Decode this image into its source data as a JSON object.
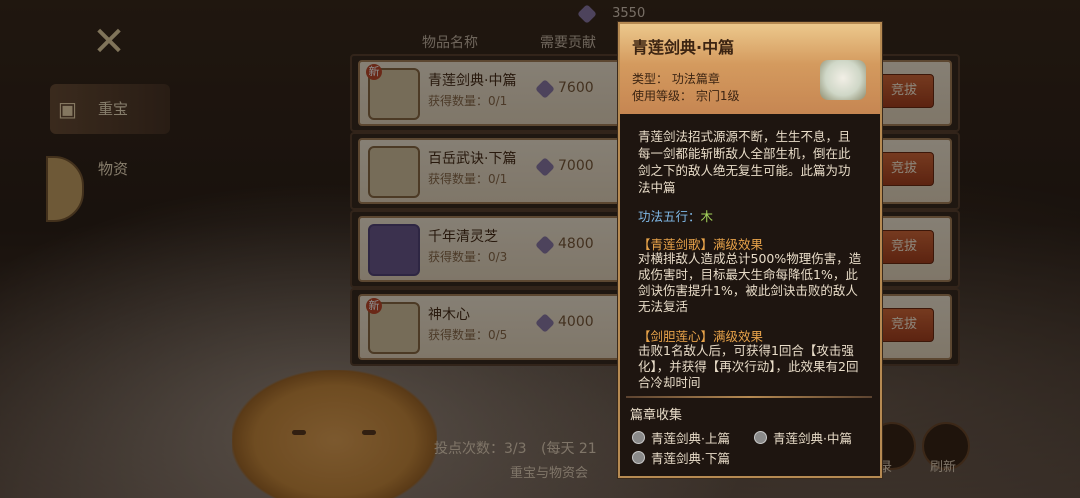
{
  "top": {
    "currency_value": "3550"
  },
  "nav": {
    "items": [
      {
        "label": "重宝",
        "active": true
      },
      {
        "label": "物资",
        "active": false
      }
    ]
  },
  "list": {
    "headers": [
      "物品名称",
      "需要贡献"
    ],
    "rows": [
      {
        "name": "青莲剑典·中篇",
        "count": "获得数量：0/1",
        "cost": "7600",
        "badge": "新",
        "bid": "竞拔"
      },
      {
        "name": "百岳武诀·下篇",
        "count": "获得数量：0/1",
        "cost": "7000",
        "badge": "",
        "bid": "竞拔"
      },
      {
        "name": "千年清灵芝",
        "count": "获得数量：0/3",
        "cost": "4800",
        "badge": "",
        "bid": "竞拔"
      },
      {
        "name": "神木心",
        "count": "获得数量：0/5",
        "cost": "4000",
        "badge": "新",
        "bid": "竞拔"
      }
    ]
  },
  "bottom": {
    "votes": "投点次数：3/3",
    "votes_suffix": "(每天 21",
    "notice": "重宝与物资会",
    "record_label": "记录",
    "refresh_label": "刷新"
  },
  "popup": {
    "title": "青莲剑典·中篇",
    "type_line": "类型：  功法篇章",
    "level_line": "使用等级：  宗门1级",
    "description": "青莲剑法招式源源不断，生生不息，且每一剑都能斩断敌人全部生机，倒在此剑之下的敌人绝无复生可能。此篇为功法中篇",
    "wuxing_label": "功法五行：",
    "wuxing_value": "木",
    "effects": [
      {
        "title": "【青莲剑歌】满级效果",
        "body": "对横排敌人造成总计500%物理伤害，造成伤害时，目标最大生命每降低1%，此剑诀伤害提升1%，被此剑诀击败的敌人无法复活"
      },
      {
        "title": "【剑胆莲心】满级效果",
        "body": "击败1名敌人后，可获得1回合【攻击强化】，并获得【再次行动】，此效果有2回合冷却时间"
      }
    ],
    "collection_title": "篇章收集",
    "collection": [
      "青莲剑典·上篇",
      "青莲剑典·中篇",
      "青莲剑典·下篇"
    ]
  }
}
